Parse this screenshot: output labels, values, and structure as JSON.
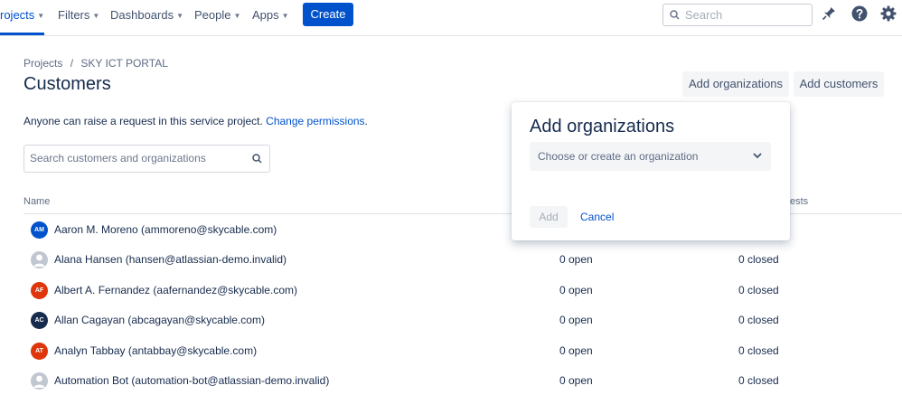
{
  "nav": {
    "items": [
      {
        "label": "rojects",
        "active": true
      },
      {
        "label": "Filters"
      },
      {
        "label": "Dashboards"
      },
      {
        "label": "People"
      },
      {
        "label": "Apps"
      }
    ],
    "create_label": "Create",
    "search_placeholder": "Search",
    "icons": [
      "notification-icon",
      "help-icon",
      "settings-icon"
    ]
  },
  "breadcrumb": {
    "items": [
      "Projects",
      "SKY ICT PORTAL"
    ],
    "separator": "/"
  },
  "page": {
    "title": "Customers",
    "add_organizations_label": "Add organizations",
    "add_customers_label": "Add customers",
    "permissions_text": "Anyone can raise a request in this service project.",
    "permissions_link": "Change permissions",
    "permissions_end": ".",
    "search_placeholder": "Search customers and organizations"
  },
  "table": {
    "columns": [
      "Name",
      "ests"
    ],
    "rows": [
      {
        "initials": "AM",
        "avatar_color": "#0052cc",
        "name": "Aaron M. Moreno (ammoreno@skycable.com)",
        "open": "",
        "closed": ""
      },
      {
        "initials": "",
        "avatar_color": "generic",
        "name": "Alana Hansen (hansen@atlassian-demo.invalid)",
        "open": "0 open",
        "closed": "0 closed"
      },
      {
        "initials": "AF",
        "avatar_color": "#de350b",
        "name": "Albert A. Fernandez (aafernandez@skycable.com)",
        "open": "0 open",
        "closed": "0 closed"
      },
      {
        "initials": "AC",
        "avatar_color": "#172b4d",
        "name": "Allan Cagayan (abcagayan@skycable.com)",
        "open": "0 open",
        "closed": "0 closed"
      },
      {
        "initials": "AT",
        "avatar_color": "#de350b",
        "name": "Analyn Tabbay (antabbay@skycable.com)",
        "open": "0 open",
        "closed": "0 closed"
      },
      {
        "initials": "",
        "avatar_color": "generic",
        "name": "Automation Bot (automation-bot@atlassian-demo.invalid)",
        "open": "0 open",
        "closed": "0 closed"
      }
    ]
  },
  "popup": {
    "title": "Add organizations",
    "select_placeholder": "Choose or create an organization",
    "add_label": "Add",
    "cancel_label": "Cancel"
  },
  "colors": {
    "brand": "#0052cc",
    "text": "#172b4d",
    "muted": "#5e6c84"
  }
}
